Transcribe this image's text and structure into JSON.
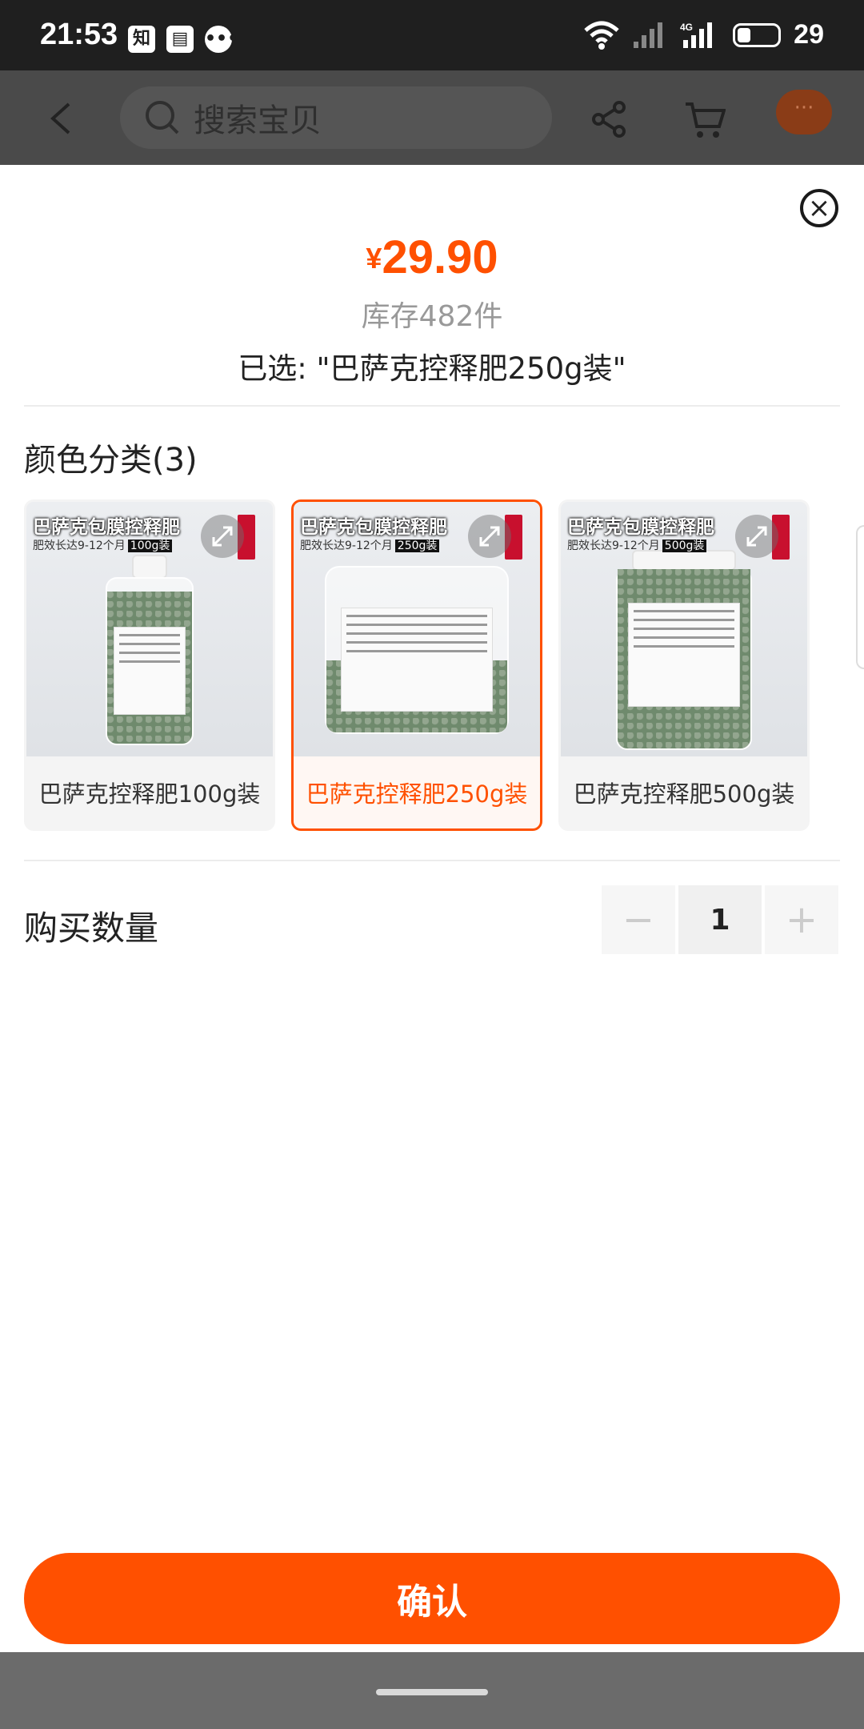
{
  "status": {
    "time": "21:53",
    "battery": "29",
    "apps": [
      "知"
    ]
  },
  "nav": {
    "search_placeholder": "搜索宝贝",
    "more": "···"
  },
  "sheet": {
    "close": "×",
    "currency": "¥",
    "price": "29.90",
    "stock": "库存482件",
    "selected": "已选: \"巴萨克控释肥250g装\"",
    "category_title": "颜色分类(3)",
    "options": [
      {
        "label": "巴萨克控释肥100g装",
        "thumb_title": "巴萨克包膜控释肥",
        "thumb_sub": "肥效长达9-12个月",
        "thumb_tag": "100g装",
        "selected": false
      },
      {
        "label": "巴萨克控释肥250g装",
        "thumb_title": "巴萨克包膜控释肥",
        "thumb_sub": "肥效长达9-12个月",
        "thumb_tag": "250g装",
        "selected": true
      },
      {
        "label": "巴萨克控释肥500g装",
        "thumb_title": "巴萨克包膜控释肥",
        "thumb_sub": "肥效长达9-12个月",
        "thumb_tag": "500g装",
        "selected": false
      }
    ],
    "quantity_label": "购买数量",
    "quantity": "1",
    "minus": "−",
    "plus": "+",
    "confirm": "确认"
  },
  "colors": {
    "accent": "#ff5000",
    "granule": "#6f8a6d",
    "statusbar": "#1f1f1f"
  }
}
